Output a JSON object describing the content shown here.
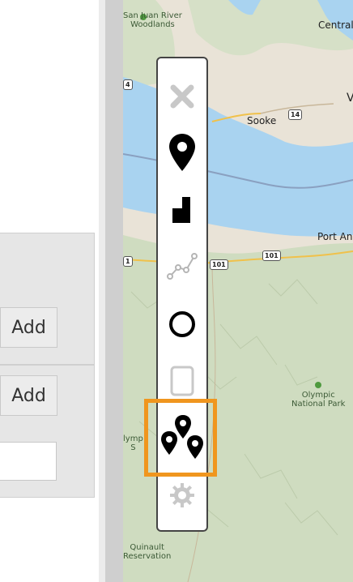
{
  "left_panel": {
    "add_buttons": [
      "Add",
      "Add"
    ],
    "text_input": {
      "value": ""
    }
  },
  "map": {
    "labels": {
      "san_juan": "San Juan River\nWoodlands",
      "central": "Central",
      "v_partial": "V",
      "sooke": "Sooke",
      "port_an": "Port An",
      "olympic_park": "Olympic\nNational Park",
      "olymp_partial": "lymp\nS",
      "quinault": "Quinault\nReservation"
    },
    "shields": {
      "hwy14": "14",
      "hwy4": "4",
      "hwy101a": "101",
      "hwy101b": "101",
      "hwy101c": "101",
      "hwy1": "1"
    }
  },
  "toolbar": {
    "tools": [
      {
        "name": "cancel",
        "icon": "close-icon",
        "enabled": false
      },
      {
        "name": "marker",
        "icon": "map-pin-icon",
        "enabled": true
      },
      {
        "name": "rectangle",
        "icon": "rectangle-icon",
        "enabled": true
      },
      {
        "name": "polyline",
        "icon": "polyline-icon",
        "enabled": false
      },
      {
        "name": "circle",
        "icon": "circle-icon",
        "enabled": true
      },
      {
        "name": "rectangle-outline",
        "icon": "square-icon",
        "enabled": false
      },
      {
        "name": "multi-marker",
        "icon": "multi-pin-icon",
        "enabled": true,
        "highlighted": true
      },
      {
        "name": "settings",
        "icon": "gear-icon",
        "enabled": false
      }
    ],
    "highlight_color": "#f0961e"
  },
  "colors": {
    "water": "#a9d3f0",
    "forest": "#cfdcc0",
    "land": "#e9e3d7"
  }
}
